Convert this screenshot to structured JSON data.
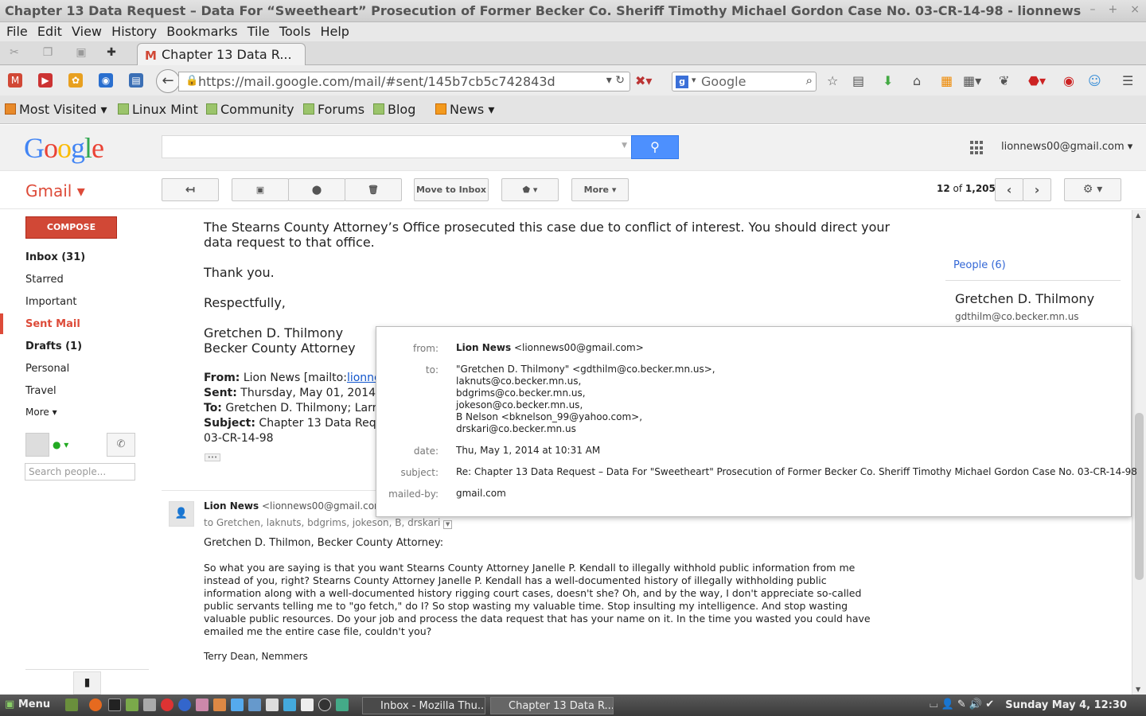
{
  "window": {
    "title": "Chapter 13 Data Request – Data For “Sweetheart” Prosecution of Former Becker Co. Sheriff Timothy Michael Gordon Case No. 03-CR-14-98 - lionnews",
    "minimize": "–",
    "maximize": "+",
    "close": "×"
  },
  "menu": [
    "File",
    "Edit",
    "View",
    "History",
    "Bookmarks",
    "Tile",
    "Tools",
    "Help"
  ],
  "tab": {
    "label": "Chapter 13 Data R..."
  },
  "nav": {
    "url": "https://mail.google.com/mail/#sent/145b7cb5c742843d",
    "search_engine": "Google"
  },
  "bookmarks": [
    "Most Visited ▾",
    "Linux Mint",
    "Community",
    "Forums",
    "Blog",
    "News ▾"
  ],
  "google": {
    "account": "lionnews00@gmail.com ▾"
  },
  "gmail": {
    "label": "Gmail ▾",
    "toolbar": {
      "move_to_inbox": "Move to Inbox",
      "more": "More ▾",
      "counter_pos": "12",
      "counter_of": " of ",
      "counter_total": "1,205"
    },
    "compose": "COMPOSE",
    "nav": [
      "Inbox (31)",
      "Starred",
      "Important",
      "Sent Mail",
      "Drafts (1)",
      "Personal",
      "Travel",
      "More ▾"
    ],
    "search_people_placeholder": "Search people..."
  },
  "message": {
    "reply_lines": [
      "The Stearns County Attorney’s Office prosecuted this case due to conflict of interest.  You should direct your",
      "data request to that office.",
      "Thank you.",
      "Respectfully,",
      "Gretchen D. Thilmony",
      "Becker County Attorney"
    ],
    "quoted": {
      "from_label": "From:",
      "from_value": " Lion News [mailto:",
      "from_link": "lionnew",
      "sent_label": "Sent:",
      "sent_value": " Thursday, May 01, 2014 7:",
      "to_label": "To:",
      "to_value": " Gretchen D. Thilmony; Larry A",
      "subject_label": "Subject:",
      "subject_value": " Chapter 13 Data Reque",
      "case": "03-CR-14-98",
      "ellipsis": "•••"
    },
    "second": {
      "sender": "Lion News",
      "sender_email": "<lionnews00@gmail.com>",
      "to_line": "to Gretchen, laknuts, bdgrims, jokeson, B, drskari",
      "greeting": "Gretchen D. Thilmon, Becker County Attorney:",
      "body": [
        "So what you are saying is that you want Stearns County Attorney Janelle P. Kendall to illegally withhold public information from me",
        "instead of you, right? Stearns County Attorney Janelle P. Kendall has a well-documented history of illegally withholding public",
        "information along with a well-documented history rigging court cases, doesn't she? Oh, and by the way, I don't appreciate so-called",
        "public servants telling me to \"go fetch,\" do I? So stop wasting my valuable time. Stop insulting my intelligence. And stop wasting",
        "valuable public resources. Do your job and process the data request that has your name on it. In the time you wasted you could have",
        "emailed me the entire case file, couldn't you?"
      ],
      "signature": "Terry Dean, Nemmers"
    }
  },
  "people_panel": {
    "title": "People (6)",
    "name": "Gretchen D. Thilmony",
    "email": "gdthilm@co.becker.mn.us"
  },
  "details_popup": {
    "from_label": "from:",
    "from_name": "Lion News",
    "from_email": " <lionnews00@gmail.com>",
    "to_label": "to:",
    "to_values": [
      "\"Gretchen D. Thilmony\" <gdthilm@co.becker.mn.us>,",
      "laknuts@co.becker.mn.us,",
      "bdgrims@co.becker.mn.us,",
      "jokeson@co.becker.mn.us,",
      "B Nelson <bknelson_99@yahoo.com>,",
      "drskari@co.becker.mn.us"
    ],
    "date_label": "date:",
    "date_value": "Thu, May 1, 2014 at 10:31 AM",
    "subject_label": "subject:",
    "subject_value": "Re: Chapter 13 Data Request – Data For \"Sweetheart\" Prosecution of Former Becker Co. Sheriff Timothy Michael Gordon Case No. 03-CR-14-98",
    "mailedby_label": "mailed-by:",
    "mailedby_value": "gmail.com"
  },
  "taskbar": {
    "menu": "Menu",
    "tasks": [
      "Inbox - Mozilla Thu...",
      "Chapter 13 Data R..."
    ],
    "clock": "Sunday May  4, 12:30"
  }
}
